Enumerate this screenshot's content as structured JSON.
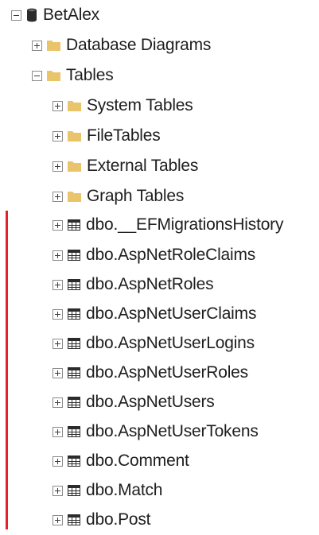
{
  "explorer": {
    "database": {
      "label": "BetAlex",
      "expanded": true
    },
    "folders": {
      "database_diagrams": {
        "label": "Database Diagrams",
        "expanded": false
      },
      "tables": {
        "label": "Tables",
        "expanded": true
      }
    },
    "table_folders": [
      {
        "label": "System Tables",
        "expanded": false
      },
      {
        "label": "FileTables",
        "expanded": false
      },
      {
        "label": "External Tables",
        "expanded": false
      },
      {
        "label": "Graph Tables",
        "expanded": false
      }
    ],
    "tables": [
      {
        "label": "dbo.__EFMigrationsHistory"
      },
      {
        "label": "dbo.AspNetRoleClaims"
      },
      {
        "label": "dbo.AspNetRoles"
      },
      {
        "label": "dbo.AspNetUserClaims"
      },
      {
        "label": "dbo.AspNetUserLogins"
      },
      {
        "label": "dbo.AspNetUserRoles"
      },
      {
        "label": "dbo.AspNetUsers"
      },
      {
        "label": "dbo.AspNetUserTokens"
      },
      {
        "label": "dbo.Comment"
      },
      {
        "label": "dbo.Match"
      },
      {
        "label": "dbo.Post"
      }
    ]
  },
  "colors": {
    "folder": "#e9c46a",
    "highlight_bar": "#e4202a",
    "text": "#1e1e1e"
  },
  "icons": {
    "database": "database-icon",
    "folder": "folder-icon",
    "table": "table-icon",
    "expand": "expand-plus-icon",
    "collapse": "collapse-minus-icon"
  }
}
